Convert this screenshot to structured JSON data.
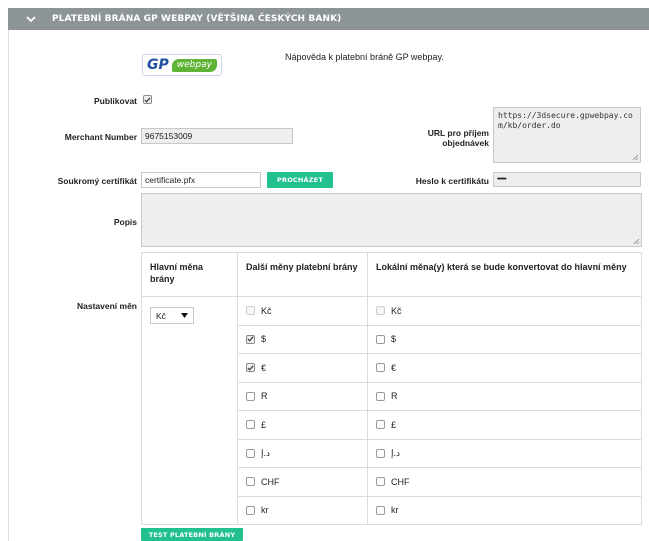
{
  "header": {
    "title": "PLATEBNÍ BRÁNA GP WEBPAY (VĚTŠINA ČESKÝCH BANK)"
  },
  "logo": {
    "gp": "GP",
    "webpay": "webpay"
  },
  "help_text": "Nápověda k platební bráně GP webpay.",
  "publish": {
    "label": "Publikovat",
    "checked": true
  },
  "merchant": {
    "label": "Merchant Number",
    "value": "9675153009"
  },
  "order_url": {
    "label": "URL pro příjem objednávek",
    "value": "https://3dsecure.gpwebpay.com/kb/order.do"
  },
  "certificate": {
    "label": "Soukromý certifikát",
    "value": "certificate.pfx",
    "browse": "PROCHÁZET"
  },
  "cert_password": {
    "label": "Heslo k certifikátu",
    "value": "••••••"
  },
  "description": {
    "label": "Popis",
    "value": ""
  },
  "currency": {
    "label": "Nastavení měn",
    "col_main": "Hlavní měna brány",
    "col_other": "Další měny platební brány",
    "col_local": "Lokální měna(y) která se bude konvertovat do hlavní měny",
    "main_selected": "Kč",
    "rows": [
      {
        "name": "Kč",
        "other": false,
        "other_disabled": true,
        "local": false,
        "local_disabled": true
      },
      {
        "name": "$",
        "other": true,
        "other_disabled": false,
        "local": false,
        "local_disabled": false
      },
      {
        "name": "€",
        "other": true,
        "other_disabled": false,
        "local": false,
        "local_disabled": false
      },
      {
        "name": "R",
        "other": false,
        "other_disabled": false,
        "local": false,
        "local_disabled": false
      },
      {
        "name": "£",
        "other": false,
        "other_disabled": false,
        "local": false,
        "local_disabled": false
      },
      {
        "name": "د.إ",
        "other": false,
        "other_disabled": false,
        "local": false,
        "local_disabled": false
      },
      {
        "name": "CHF",
        "other": false,
        "other_disabled": false,
        "local": false,
        "local_disabled": false
      },
      {
        "name": "kr",
        "other": false,
        "other_disabled": false,
        "local": false,
        "local_disabled": false
      }
    ]
  },
  "test_button": "TEST PLATEBNÍ BRÁNY",
  "colors": {
    "header": "#8d9498",
    "accent": "#23c08f",
    "input_bg": "#eeeeee"
  }
}
